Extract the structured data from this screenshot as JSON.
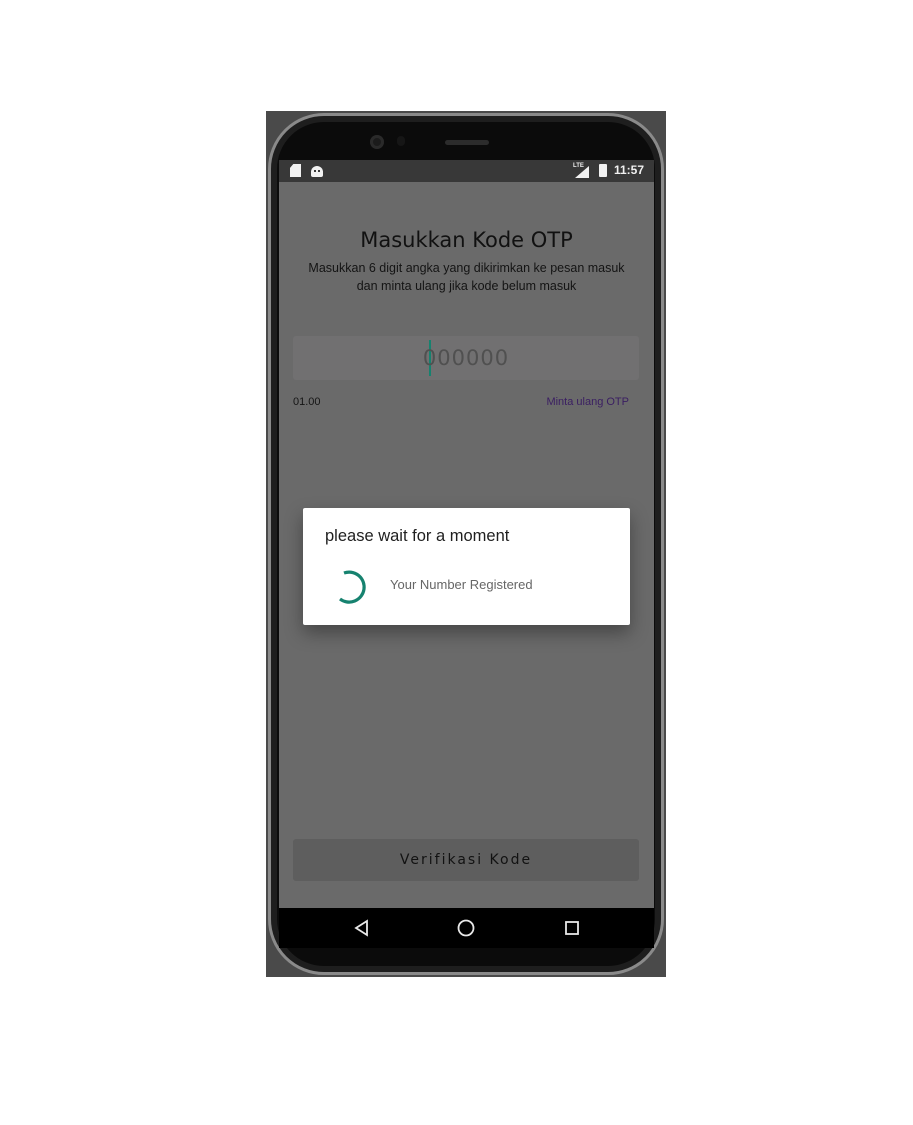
{
  "status_bar": {
    "network_label": "LTE",
    "time": "11:57"
  },
  "otp_screen": {
    "title": "Masukkan Kode OTP",
    "subtitle": "Masukkan 6 digit angka yang dikirimkan ke pesan masuk dan minta ulang jika kode belum masuk",
    "otp_input": {
      "placeholder": "000000",
      "value": ""
    },
    "timer": "01.00",
    "resend_label": "Minta ulang OTP",
    "verify_label": "Verifikasi Kode"
  },
  "dialog": {
    "title": "please wait for a moment",
    "message": "Your Number Registered"
  },
  "colors": {
    "accent": "#16826f",
    "resend_link": "#3a1e62",
    "overlay_dimmed": "#6a6a6a"
  },
  "icons": {
    "nav_back": "triangle-back-icon",
    "nav_home": "circle-home-icon",
    "nav_recent": "square-recent-icon"
  }
}
